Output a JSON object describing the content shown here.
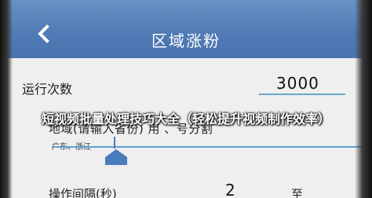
{
  "header": {
    "title": "区域涨粉",
    "back_icon": "chevron-left-icon",
    "color": "#4f7ab5"
  },
  "form": {
    "run_count": {
      "label": "运行次数",
      "value": "3000"
    },
    "region": {
      "label": "地域(请输入省份) 用 、号分割",
      "value": "广东、浙江"
    },
    "interval": {
      "label": "操作间隔(秒)",
      "from": "2",
      "to_label": "至"
    }
  },
  "overlay": {
    "title": "短视频批量处理技巧大全（轻松提升视频制作效率）"
  },
  "colors": {
    "accent_line": "#5f9fcf",
    "background": "#efefef"
  }
}
